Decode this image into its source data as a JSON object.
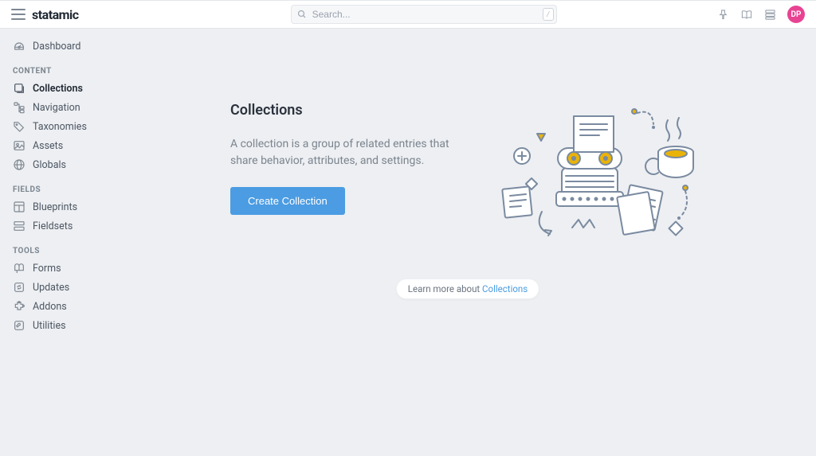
{
  "brand": "statamic",
  "search": {
    "placeholder": "Search...",
    "shortcut": "/"
  },
  "avatar": {
    "initials": "DP"
  },
  "sidebar": {
    "dashboard": "Dashboard",
    "groups": [
      {
        "heading": "CONTENT",
        "items": [
          {
            "key": "collections",
            "label": "Collections",
            "active": true
          },
          {
            "key": "navigation",
            "label": "Navigation"
          },
          {
            "key": "taxonomies",
            "label": "Taxonomies"
          },
          {
            "key": "assets",
            "label": "Assets"
          },
          {
            "key": "globals",
            "label": "Globals"
          }
        ]
      },
      {
        "heading": "FIELDS",
        "items": [
          {
            "key": "blueprints",
            "label": "Blueprints"
          },
          {
            "key": "fieldsets",
            "label": "Fieldsets"
          }
        ]
      },
      {
        "heading": "TOOLS",
        "items": [
          {
            "key": "forms",
            "label": "Forms"
          },
          {
            "key": "updates",
            "label": "Updates"
          },
          {
            "key": "addons",
            "label": "Addons"
          },
          {
            "key": "utilities",
            "label": "Utilities"
          }
        ]
      }
    ]
  },
  "page": {
    "title": "Collections",
    "description": "A collection is a group of related entries that share behavior, attributes, and settings.",
    "cta": "Create Collection",
    "learn_prefix": "Learn more about ",
    "learn_link": "Collections"
  }
}
